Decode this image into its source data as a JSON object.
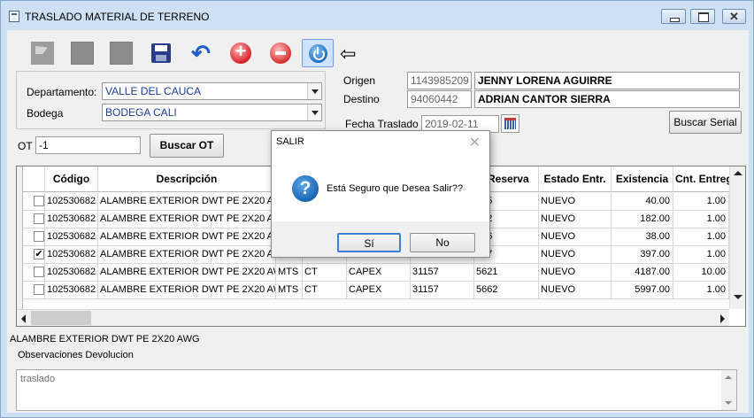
{
  "window": {
    "title": "TRASLADO MATERIAL DE TERRENO",
    "close_glyph": "✕"
  },
  "toolbar": {
    "arrow_glyph": "⇦"
  },
  "form": {
    "departamento_label": "Departamento:",
    "departamento_value": "VALLE DEL CAUCA",
    "bodega_label": "Bodega",
    "bodega_value": "BODEGA CALI",
    "origen_label": "Origen",
    "origen_id": "1143985209",
    "origen_name": "JENNY LORENA AGUIRRE",
    "destino_label": "Destino",
    "destino_id": "94060442",
    "destino_name": "ADRIAN CANTOR SIERRA",
    "fecha_label": "Fecha Traslado",
    "fecha_value": "2019-02-11",
    "buscar_serial": "Buscar Serial",
    "ot_label": "OT",
    "ot_value": "-1",
    "buscar_ot": "Buscar OT"
  },
  "grid": {
    "headers": {
      "codigo": "Código",
      "descripcion": "Descripción",
      "reserva": "Reserva",
      "estado": "Estado Entr.",
      "existencia": "Existencia",
      "cnt": "Cnt. Entreg"
    },
    "rows": [
      {
        "checked": "",
        "codigo": "102530682",
        "desc": "ALAMBRE EXTERIOR DWT PE 2X20 AWG",
        "unidad": "",
        "tipo": "",
        "clase": "",
        "ot": "",
        "reserva": "145",
        "estado": "NUEVO",
        "existencia": "40.00",
        "cnt": "1.00"
      },
      {
        "checked": "",
        "codigo": "102530682",
        "desc": "ALAMBRE EXTERIOR DWT PE 2X20 AWG",
        "unidad": "",
        "tipo": "",
        "clase": "",
        "ot": "",
        "reserva": "172",
        "estado": "NUEVO",
        "existencia": "182.00",
        "cnt": "1.00"
      },
      {
        "checked": "",
        "codigo": "102530682",
        "desc": "ALAMBRE EXTERIOR DWT PE 2X20 AWG",
        "unidad": "",
        "tipo": "",
        "clase": "",
        "ot": "",
        "reserva": "136",
        "estado": "NUEVO",
        "existencia": "38.00",
        "cnt": "1.00"
      },
      {
        "checked": "✔",
        "codigo": "102530682",
        "desc": "ALAMBRE EXTERIOR DWT PE 2X20 AWG",
        "unidad": "",
        "tipo": "",
        "clase": "",
        "ot": "",
        "reserva": "187",
        "estado": "NUEVO",
        "existencia": "397.00",
        "cnt": "1.00"
      },
      {
        "checked": "",
        "codigo": "102530682",
        "desc": "ALAMBRE EXTERIOR DWT PE 2X20 AWG",
        "unidad": "MTS",
        "tipo": "CT",
        "clase": "CAPEX",
        "ot": "31157",
        "reserva": "5621",
        "estado": "NUEVO",
        "existencia": "4187.00",
        "cnt": "10.00"
      },
      {
        "checked": "",
        "codigo": "102530682",
        "desc": "ALAMBRE EXTERIOR DWT PE 2X20 AWG",
        "unidad": "MTS",
        "tipo": "CT",
        "clase": "CAPEX",
        "ot": "31157",
        "reserva": "5662",
        "estado": "NUEVO",
        "existencia": "5997.00",
        "cnt": "1.00"
      }
    ]
  },
  "selected_description": "ALAMBRE EXTERIOR DWT PE 2X20 AWG",
  "observaciones": {
    "label": "Observaciones Devolucion",
    "value": "traslado"
  },
  "dialog": {
    "title": "SALIR",
    "close_glyph": "✕",
    "icon_glyph": "?",
    "message": "Está Seguro que Desea Salir??",
    "yes": "Sí",
    "no": "No"
  }
}
